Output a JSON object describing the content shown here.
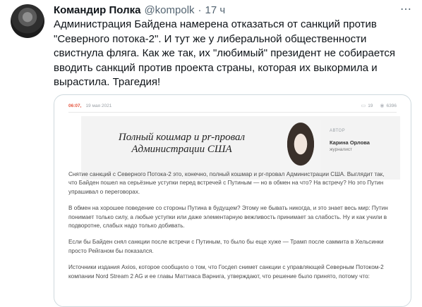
{
  "tweet": {
    "author_name": "Командир Полка",
    "handle": "@kompolk",
    "separator": "·",
    "time": "17 ч",
    "more_icon": "more-horizontal-icon",
    "text": "Администрация Байдена намерена отказаться от санкций против\n\"Северного потока-2\". И тут же у либеральной общественности\nсвистнула фляга. Как же так, их \"любимый\" президент не собирается\nвводить санкций против проекта страны, которая их выкормила и\nвырастила. Трагедия!"
  },
  "article": {
    "time": "06:07,",
    "date": "19 мая 2021",
    "comments": "19",
    "views": "6396",
    "headline": "Полный кошмар и pr-провал\nАдминистрации США",
    "author_label": "АВТОР",
    "author_name": "Карина Орлова",
    "author_role": "журналист",
    "paragraphs": [
      "Снятие санкций с Северного Потока-2 это, конечно, полный кошмар и pr-провал Администрации США. Выглядит так, что Байден пошел на серьёзные уступки перед встречей с Путиным — но в обмен на что? На встречу? Но это Путин упрашивал о переговорах.",
      "В обмен на хорошее поведение со стороны Путина в будущем? Этому не бывать никогда, и это знает весь мир: Путин понимает только силу, а любые уступки или даже элементарную вежливость принимает за слабость. Ну и как учили в подворотне, слабых надо только добивать.",
      "Если бы Байден снял санкции после встречи с Путиным, то было бы еще хуже — Трамп после саммита в Хельсинки просто Рейганом бы показался.",
      "Источники издания Axios, которое сообщило о том, что Госдеп снимет санкции с управляющей Северным Потоком-2 компании Nord Stream 2 AG и ее главы Маттиаса Варнига, утверждают, что решение было принято, потому что:"
    ]
  }
}
